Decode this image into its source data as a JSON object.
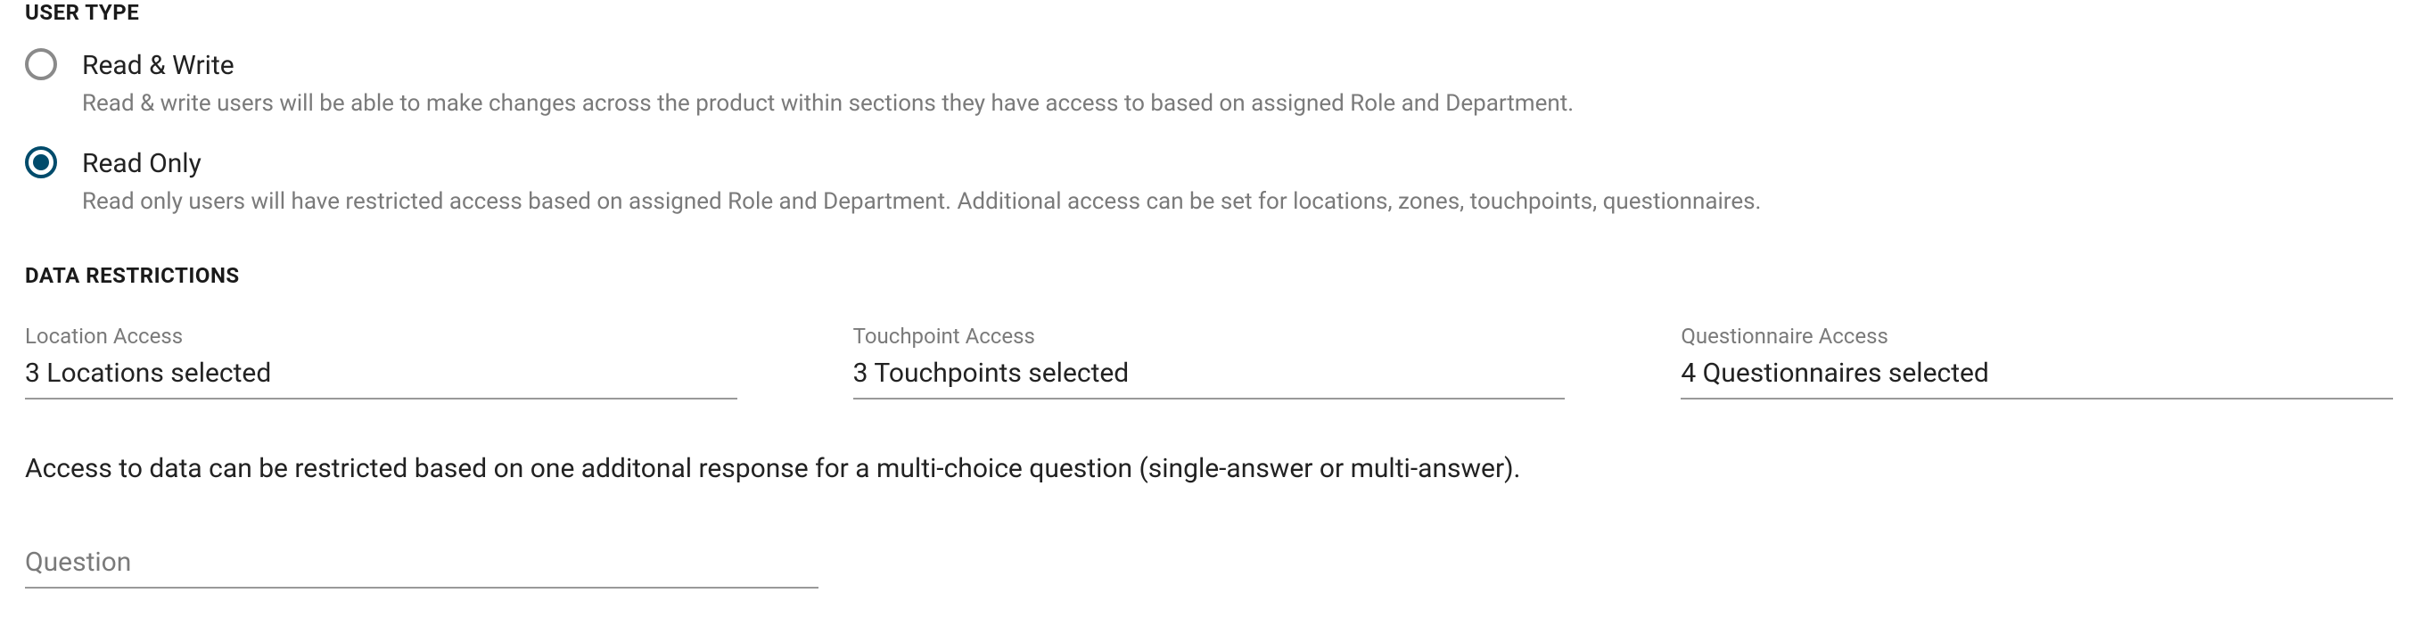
{
  "userType": {
    "heading": "USER TYPE",
    "options": [
      {
        "label": "Read & Write",
        "description": "Read & write users will be able to make changes across the product within sections they have access to based on assigned Role and Department.",
        "selected": false
      },
      {
        "label": "Read Only",
        "description": "Read only users will have restricted access based on assigned Role and Department. Additional access can be set for locations, zones, touchpoints, questionnaires.",
        "selected": true
      }
    ]
  },
  "dataRestrictions": {
    "heading": "DATA RESTRICTIONS",
    "fields": [
      {
        "label": "Location Access",
        "value": "3 Locations selected"
      },
      {
        "label": "Touchpoint Access",
        "value": "3 Touchpoints selected"
      },
      {
        "label": "Questionnaire Access",
        "value": "4 Questionnaires selected"
      }
    ],
    "infoText": "Access to data can be restricted based on one additonal response for a multi-choice question (single-answer or multi-answer).",
    "questionPlaceholder": "Question"
  }
}
